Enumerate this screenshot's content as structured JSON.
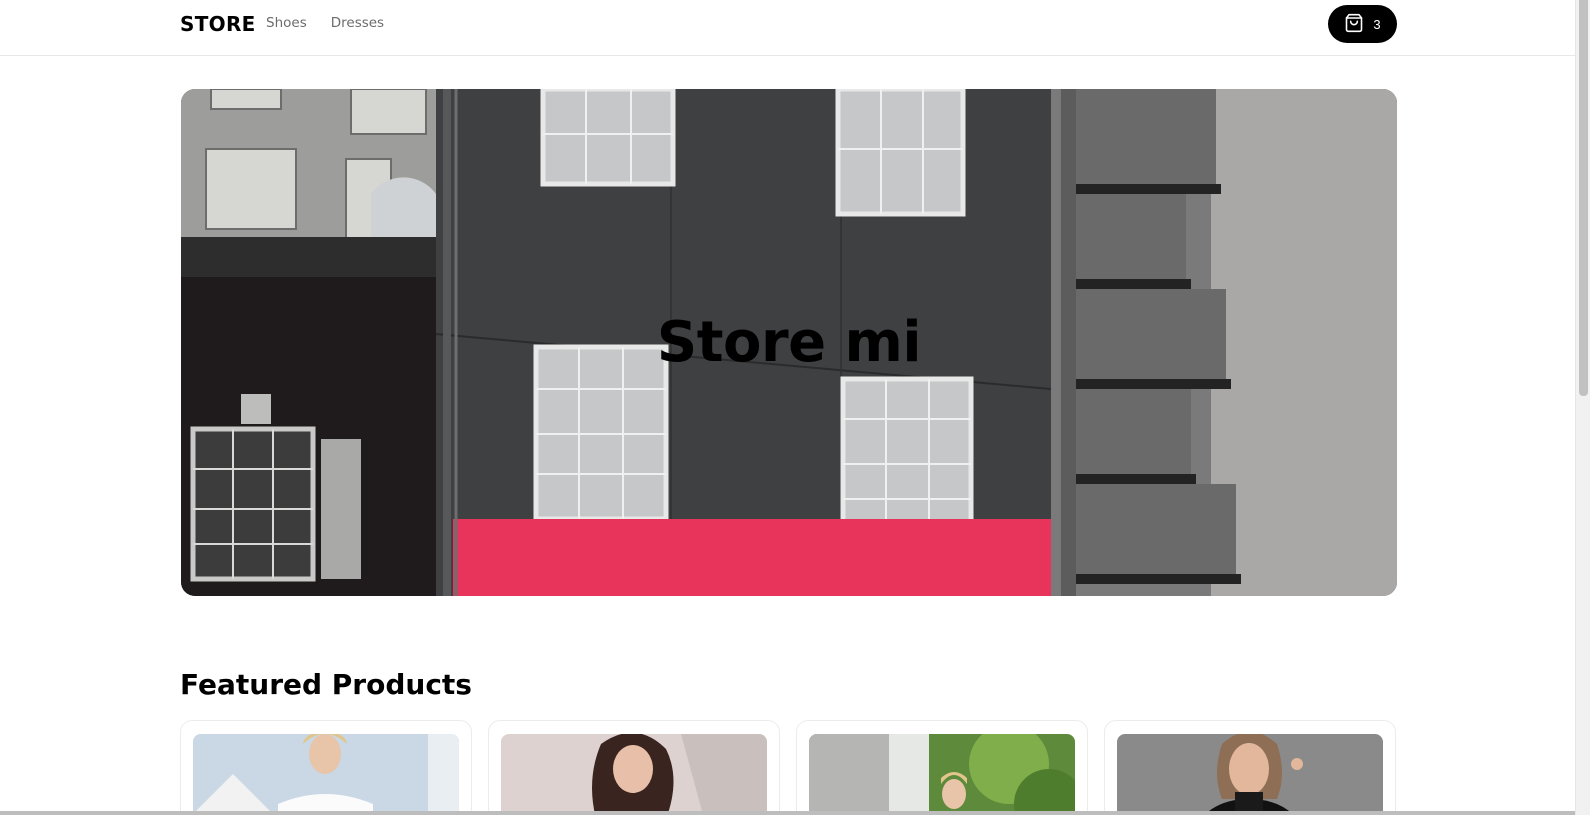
{
  "header": {
    "logo": "STORE",
    "nav": [
      {
        "label": "Shoes"
      },
      {
        "label": "Dresses"
      }
    ],
    "cart": {
      "count": "3",
      "icon": "shopping-bag-icon"
    }
  },
  "hero": {
    "title": "Store mi",
    "image": "building-facade-photo"
  },
  "featured": {
    "title": "Featured Products",
    "products": [
      {
        "image": "woman-white-offshoulder-dress-photo"
      },
      {
        "image": "woman-red-top-smiling-photo"
      },
      {
        "image": "woman-red-dress-garden-photo"
      },
      {
        "image": "woman-black-turtleneck-photo"
      }
    ]
  },
  "colors": {
    "accent": "#000000",
    "hero_sign": "#e8345a",
    "muted_text": "#6b6b6b"
  }
}
